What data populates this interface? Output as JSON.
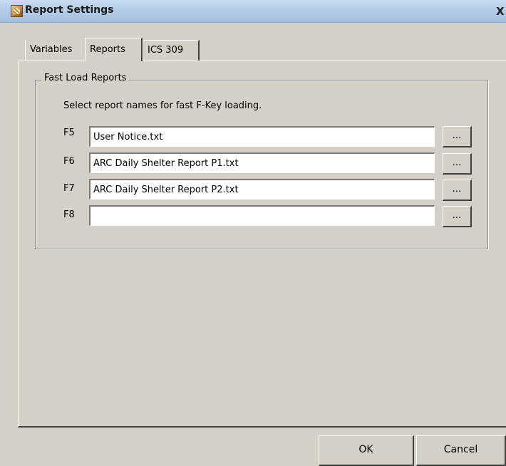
{
  "window": {
    "title": "Report Settings",
    "icon": "report-settings-app-icon",
    "close_label": "X"
  },
  "tabs": [
    {
      "label": "Variables",
      "active": false
    },
    {
      "label": "Reports",
      "active": true
    },
    {
      "label": "ICS 309",
      "active": false
    }
  ],
  "group": {
    "legend": "Fast Load Reports",
    "instruction": "Select report names for fast F-Key loading."
  },
  "rows": [
    {
      "key": "F5",
      "value": "User Notice.txt",
      "browse_label": "..."
    },
    {
      "key": "F6",
      "value": "ARC Daily Shelter Report P1.txt",
      "browse_label": "..."
    },
    {
      "key": "F7",
      "value": "ARC Daily Shelter Report P2.txt",
      "browse_label": "..."
    },
    {
      "key": "F8",
      "value": "",
      "browse_label": "..."
    }
  ],
  "buttons": {
    "ok": "OK",
    "cancel": "Cancel"
  }
}
